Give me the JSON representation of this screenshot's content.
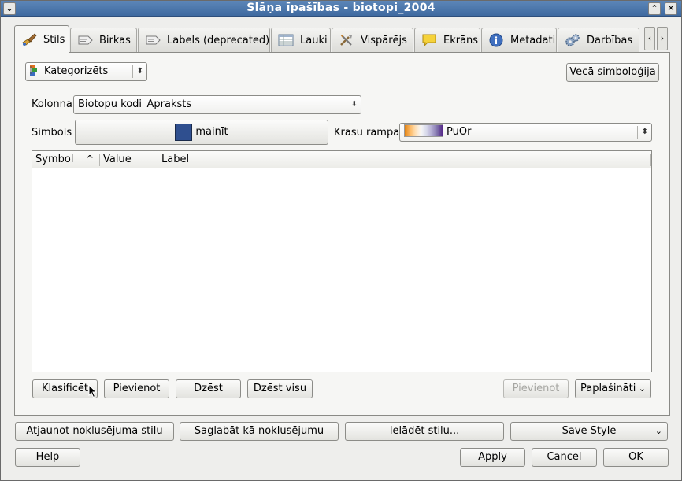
{
  "window": {
    "title": "Slāņa īpašības - biotopi_2004",
    "menu_glyph": "⌄",
    "minimize_glyph": "⌃",
    "close_glyph": "✕"
  },
  "tabs": [
    {
      "label": "Stils",
      "icon": "brush-icon",
      "active": true
    },
    {
      "label": "Birkas",
      "icon": "label-icon"
    },
    {
      "label": "Labels (deprecated)",
      "icon": "label-deprecated-icon"
    },
    {
      "label": "Lauki",
      "icon": "table-icon"
    },
    {
      "label": "Vispārējs",
      "icon": "tools-icon"
    },
    {
      "label": "Ekrāns",
      "icon": "speech-bubble-icon"
    },
    {
      "label": "Metadati",
      "icon": "info-icon"
    },
    {
      "label": "Darbības",
      "icon": "gears-icon"
    }
  ],
  "tab_scroll": {
    "left": "‹",
    "right": "›"
  },
  "renderer": {
    "value": "Kategorizēts",
    "icon": "categorized-icon"
  },
  "old_symbology_button": "Vecā simboloģija",
  "column": {
    "label": "Kolonna",
    "value": "Biotopu kodi_Apraksts"
  },
  "symbol": {
    "label": "Simbols",
    "button_label": "mainīt",
    "swatch_color": "#2f4f8f"
  },
  "color_ramp": {
    "label": "Krāsu rampa",
    "value": "PuOr"
  },
  "table": {
    "headers": [
      "Symbol",
      "Value",
      "Label"
    ],
    "sort_indicator": "^",
    "rows": []
  },
  "actions": {
    "classify": "Klasificēt",
    "add": "Pievienot",
    "delete": "Dzēst",
    "delete_all": "Dzēst visu",
    "add_disabled": "Pievienot",
    "advanced": "Paplašināti"
  },
  "style_buttons": {
    "restore_default": "Atjaunot noklusējuma stilu",
    "save_default": "Saglabāt kā noklusējumu",
    "load_style": "Ielādēt stilu...",
    "save_style": "Save Style"
  },
  "footer": {
    "help": "Help",
    "apply": "Apply",
    "cancel": "Cancel",
    "ok": "OK"
  },
  "colors": {
    "titlebar": "#4f78ab",
    "ramp": [
      "#e08214",
      "#fdb863",
      "#fee0b6",
      "#f7f7f7",
      "#d8daeb",
      "#b2abd2",
      "#8073ac",
      "#542788"
    ]
  }
}
